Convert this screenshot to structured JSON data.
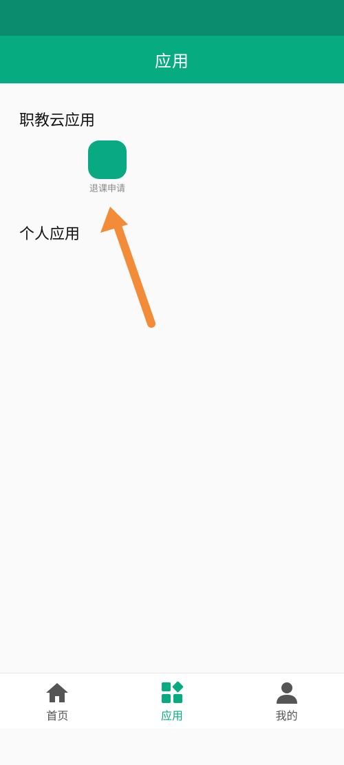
{
  "colors": {
    "status_bar": "#0b8c6e",
    "header": "#07ab80",
    "accent": "#07ab80",
    "arrow": "#f28c38",
    "inactive_nav": "#555555"
  },
  "header": {
    "title": "应用"
  },
  "sections": {
    "cloud_apps": {
      "title": "职教云应用",
      "apps": [
        {
          "label": "退课申请",
          "icon": "app-icon"
        }
      ]
    },
    "personal_apps": {
      "title": "个人应用"
    }
  },
  "bottom_nav": {
    "items": [
      {
        "label": "首页",
        "icon": "home-icon",
        "active": false
      },
      {
        "label": "应用",
        "icon": "apps-grid-icon",
        "active": true
      },
      {
        "label": "我的",
        "icon": "user-icon",
        "active": false
      }
    ]
  }
}
